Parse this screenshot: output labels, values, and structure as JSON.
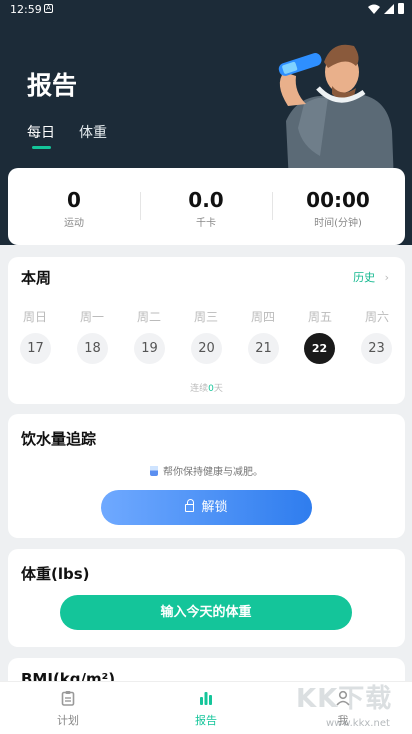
{
  "status_bar": {
    "time": "12:59",
    "notification": "A"
  },
  "header": {
    "title": "报告",
    "tabs": [
      {
        "label": "每日",
        "active": true
      },
      {
        "label": "体重",
        "active": false
      }
    ]
  },
  "stats": [
    {
      "value": "0",
      "label": "运动"
    },
    {
      "value": "0.0",
      "label": "千卡"
    },
    {
      "value": "00:00",
      "label": "时间(分钟)"
    }
  ],
  "week": {
    "title": "本周",
    "history_label": "历史",
    "days": [
      {
        "name": "周日",
        "date": "17",
        "today": false
      },
      {
        "name": "周一",
        "date": "18",
        "today": false
      },
      {
        "name": "周二",
        "date": "19",
        "today": false
      },
      {
        "name": "周三",
        "date": "20",
        "today": false
      },
      {
        "name": "周四",
        "date": "21",
        "today": false
      },
      {
        "name": "周五",
        "date": "22",
        "today": true
      },
      {
        "name": "周六",
        "date": "23",
        "today": false
      }
    ],
    "streak_prefix": "连续",
    "streak_count": "0",
    "streak_suffix": "天"
  },
  "water": {
    "title": "饮水量追踪",
    "tip": "帮你保持健康与减肥。",
    "unlock_label": "解锁"
  },
  "weight": {
    "title": "体重(lbs)",
    "button_label": "输入今天的体重"
  },
  "bmi": {
    "title": "BMI(kg/m²)"
  },
  "nav": [
    {
      "label": "计划",
      "icon": "clipboard-icon",
      "active": false
    },
    {
      "label": "报告",
      "icon": "bar-chart-icon",
      "active": true
    },
    {
      "label": "我",
      "icon": "user-icon",
      "active": false
    }
  ],
  "watermark": {
    "text": "KK下载",
    "url": "www.kkx.net"
  },
  "colors": {
    "accent": "#14c59a",
    "hero_bg": "#1c2b38",
    "unlock_start": "#6fa9ff",
    "unlock_end": "#2f7dee"
  }
}
